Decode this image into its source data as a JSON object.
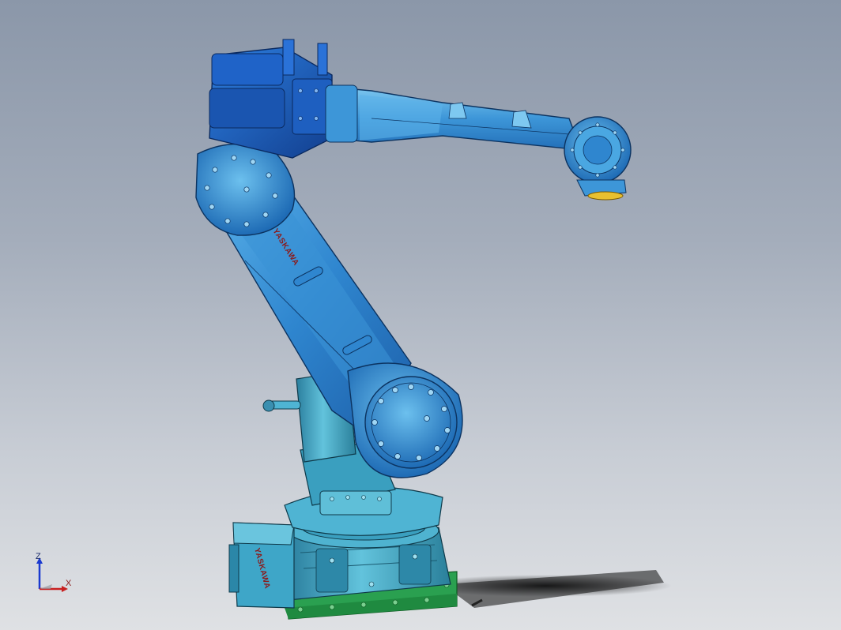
{
  "viewport": {
    "background_top": "#8b97a9",
    "background_bottom": "#dfe1e4"
  },
  "model": {
    "brand_label": "YASKAWA",
    "base_brand_label": "YASKAWA",
    "colors": {
      "arm_blue": "#1f6fc0",
      "arm_light": "#48a3e0",
      "motor_dark": "#1a55b0",
      "base_teal": "#3a9fbf",
      "base_light": "#5fbfd8",
      "pad_green": "#2aa050",
      "tool_flange": "#e8c030",
      "brand_red": "#8b1a1a"
    }
  },
  "triad": {
    "z_label": "Z",
    "x_label": "X",
    "z_color": "#1a3ad0",
    "x_color": "#c82020"
  }
}
